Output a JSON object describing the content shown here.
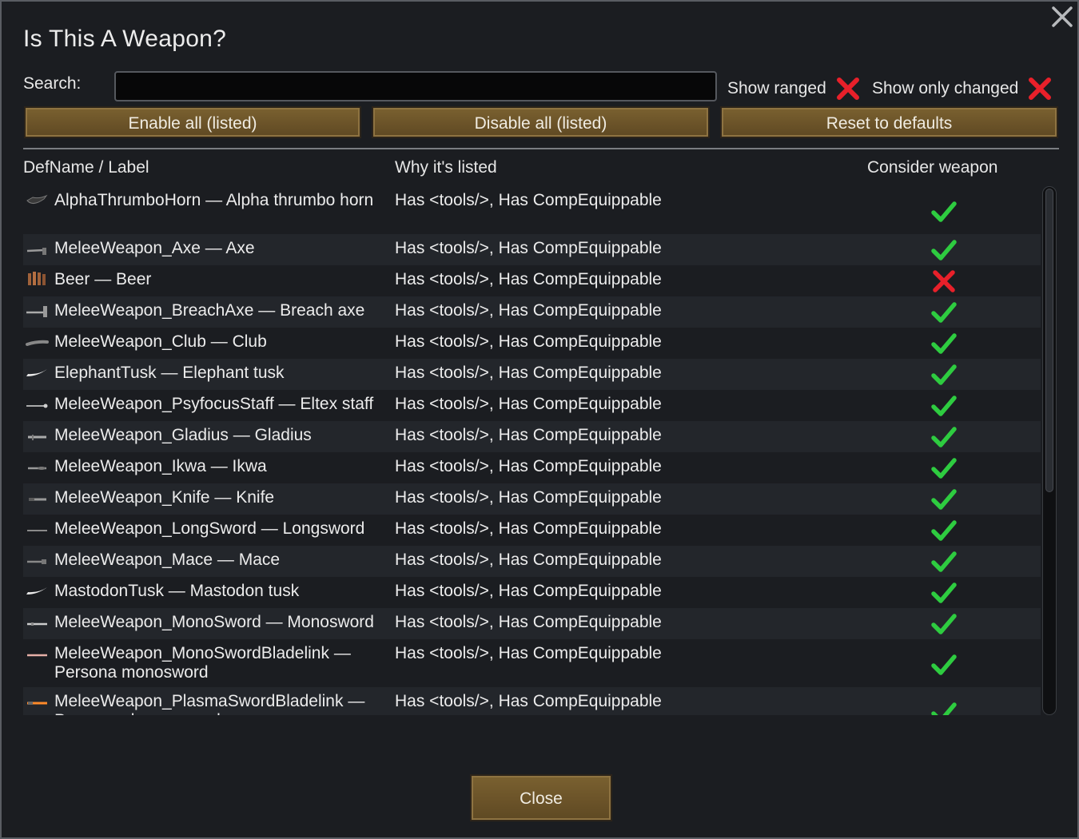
{
  "dialog": {
    "title": "Is This A Weapon?",
    "close_icon": "close-x-icon"
  },
  "search": {
    "label": "Search:",
    "value": "",
    "placeholder": ""
  },
  "toggles": {
    "show_ranged": {
      "label": "Show ranged",
      "state": "off"
    },
    "show_only_changed": {
      "label": "Show only changed",
      "state": "off"
    }
  },
  "buttons": {
    "enable_all": "Enable all (listed)",
    "disable_all": "Disable all (listed)",
    "reset": "Reset to defaults",
    "close": "Close"
  },
  "table": {
    "headers": {
      "def": "DefName / Label",
      "why": "Why it's listed",
      "consider": "Consider weapon"
    },
    "rows": [
      {
        "def": "AlphaThrumboHorn — Alpha thrumbo horn",
        "why": "Has <tools/>, Has CompEquippable",
        "consider": true,
        "icon": "horn-icon",
        "tall": true
      },
      {
        "def": "MeleeWeapon_Axe — Axe",
        "why": "Has <tools/>, Has CompEquippable",
        "consider": true,
        "icon": "axe-icon"
      },
      {
        "def": "Beer — Beer",
        "why": "Has <tools/>, Has CompEquippable",
        "consider": false,
        "icon": "beer-icon"
      },
      {
        "def": "MeleeWeapon_BreachAxe — Breach axe",
        "why": "Has <tools/>, Has CompEquippable",
        "consider": true,
        "icon": "breach-axe-icon"
      },
      {
        "def": "MeleeWeapon_Club — Club",
        "why": "Has <tools/>, Has CompEquippable",
        "consider": true,
        "icon": "club-icon"
      },
      {
        "def": "ElephantTusk — Elephant tusk",
        "why": "Has <tools/>, Has CompEquippable",
        "consider": true,
        "icon": "tusk-icon"
      },
      {
        "def": "MeleeWeapon_PsyfocusStaff — Eltex staff",
        "why": "Has <tools/>, Has CompEquippable",
        "consider": true,
        "icon": "staff-icon"
      },
      {
        "def": "MeleeWeapon_Gladius — Gladius",
        "why": "Has <tools/>, Has CompEquippable",
        "consider": true,
        "icon": "gladius-icon"
      },
      {
        "def": "MeleeWeapon_Ikwa — Ikwa",
        "why": "Has <tools/>, Has CompEquippable",
        "consider": true,
        "icon": "ikwa-icon"
      },
      {
        "def": "MeleeWeapon_Knife — Knife",
        "why": "Has <tools/>, Has CompEquippable",
        "consider": true,
        "icon": "knife-icon"
      },
      {
        "def": "MeleeWeapon_LongSword — Longsword",
        "why": "Has <tools/>, Has CompEquippable",
        "consider": true,
        "icon": "longsword-icon"
      },
      {
        "def": "MeleeWeapon_Mace — Mace",
        "why": "Has <tools/>, Has CompEquippable",
        "consider": true,
        "icon": "mace-icon"
      },
      {
        "def": "MastodonTusk — Mastodon tusk",
        "why": "Has <tools/>, Has CompEquippable",
        "consider": true,
        "icon": "tusk-icon"
      },
      {
        "def": "MeleeWeapon_MonoSword — Monosword",
        "why": "Has <tools/>, Has CompEquippable",
        "consider": true,
        "icon": "monosword-icon"
      },
      {
        "def": "MeleeWeapon_MonoSwordBladelink — Persona monosword",
        "why": "Has <tools/>, Has CompEquippable",
        "consider": true,
        "icon": "persona-monosword-icon",
        "tall": true
      },
      {
        "def": "MeleeWeapon_PlasmaSwordBladelink — Persona plasmasword",
        "why": "Has <tools/>, Has CompEquippable",
        "consider": true,
        "icon": "plasmasword-icon",
        "tall": true
      }
    ]
  },
  "colors": {
    "check": "#2ecc40",
    "cross": "#e8202a",
    "button": "#6e5529"
  }
}
